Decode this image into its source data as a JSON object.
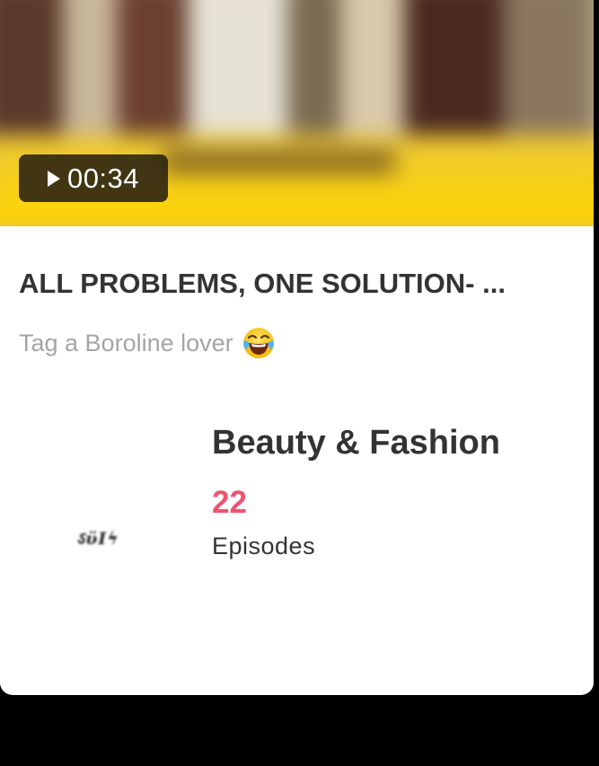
{
  "video": {
    "duration": "00:34",
    "play_icon": "play-icon"
  },
  "post": {
    "title": "ALL PROBLEMS, ONE SOLUTION- ...",
    "caption": "Tag a Boroline lover",
    "caption_emoji_icon": "face-with-tears-of-joy-icon"
  },
  "channel": {
    "category": "Beauty & Fashion",
    "episode_count": "22",
    "episode_label": "Episodes",
    "accent_color": "#f0536f"
  }
}
